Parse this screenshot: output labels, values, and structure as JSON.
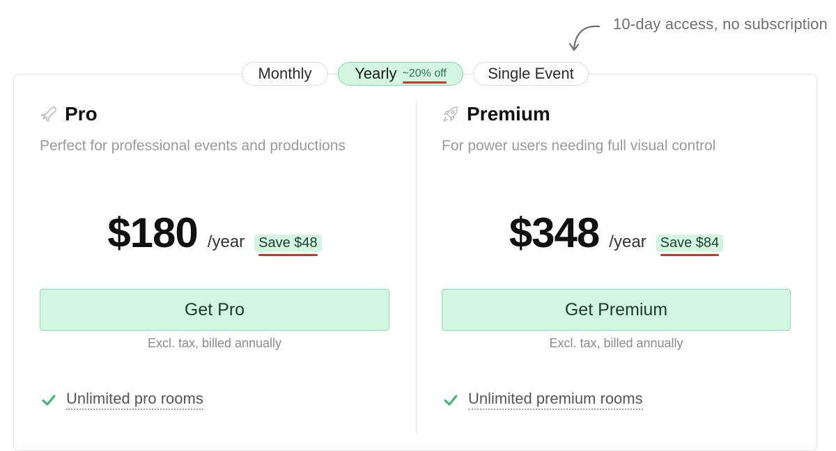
{
  "annotation": {
    "text": "10-day access, no subscription"
  },
  "billing_toggle": {
    "options": [
      {
        "label": "Monthly"
      },
      {
        "label": "Yearly",
        "badge": "~20% off",
        "selected": true
      },
      {
        "label": "Single Event"
      }
    ]
  },
  "plans": [
    {
      "icon": "airplane-icon",
      "name": "Pro",
      "description": "Perfect for professional events and productions",
      "price": "$180",
      "period": "/year",
      "savings": "Save $48",
      "cta_label": "Get Pro",
      "billing_note": "Excl. tax, billed annually",
      "features": [
        "Unlimited pro rooms"
      ]
    },
    {
      "icon": "rocket-icon",
      "name": "Premium",
      "description": "For power users needing full visual control",
      "price": "$348",
      "period": "/year",
      "savings": "Save $84",
      "cta_label": "Get Premium",
      "billing_note": "Excl. tax, billed annually",
      "features": [
        "Unlimited premium rooms"
      ]
    }
  ],
  "colors": {
    "accent_fill": "#d3f5e1",
    "accent_border": "#8cdcae",
    "check": "#3cb371",
    "underline": "#c0392b"
  }
}
